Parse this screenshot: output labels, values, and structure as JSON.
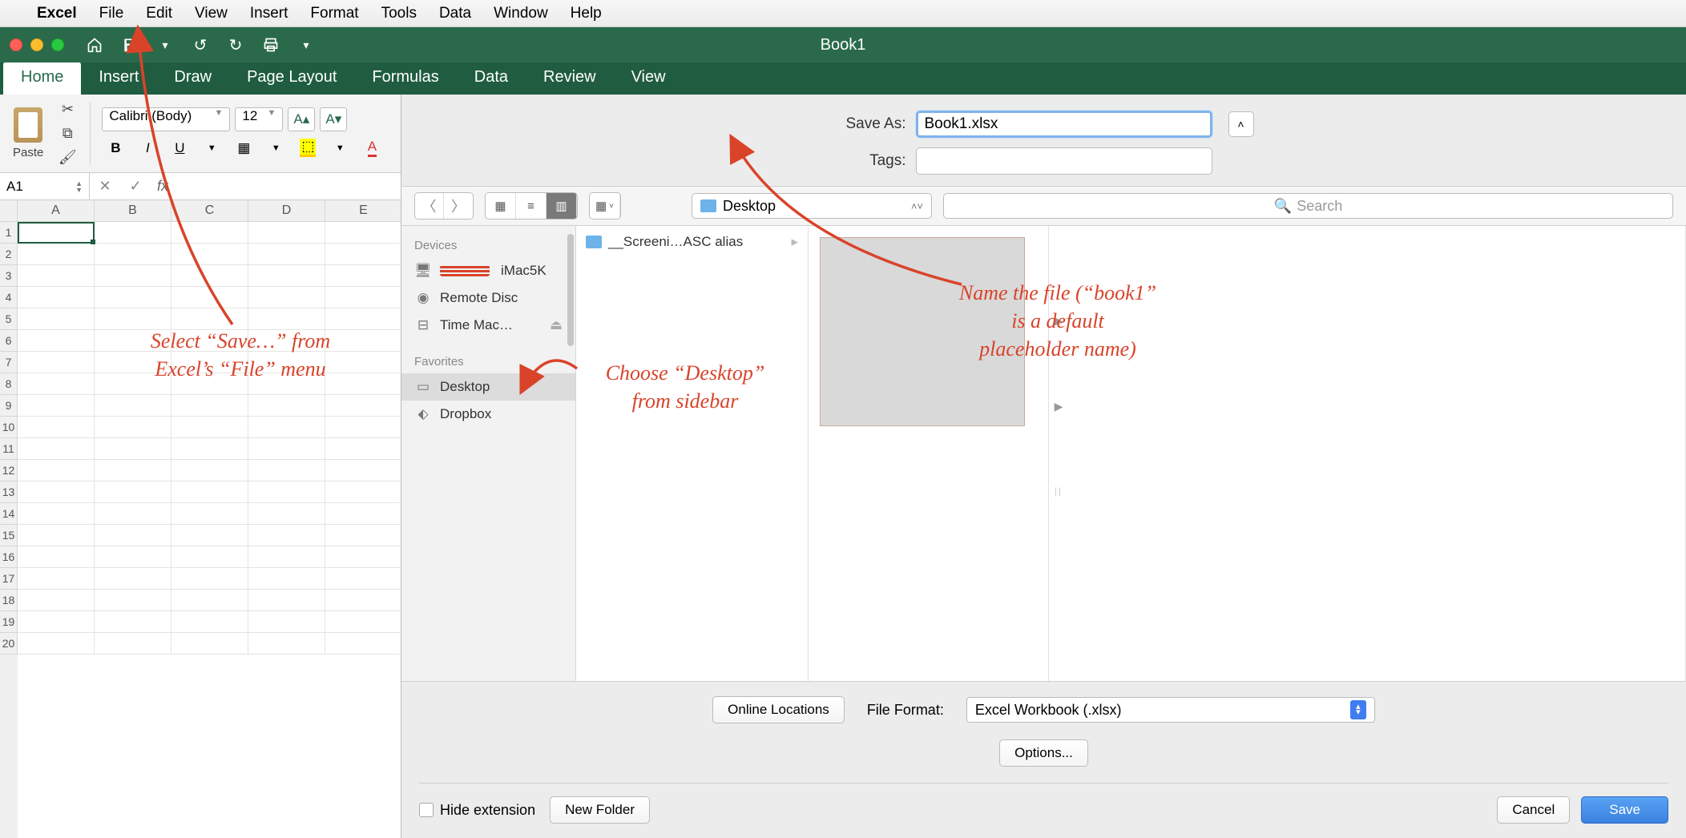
{
  "menubar": {
    "items": [
      "Excel",
      "File",
      "Edit",
      "View",
      "Insert",
      "Format",
      "Tools",
      "Data",
      "Window",
      "Help"
    ]
  },
  "titlebar": {
    "title": "Book1"
  },
  "ribbon_tabs": [
    "Home",
    "Insert",
    "Draw",
    "Page Layout",
    "Formulas",
    "Data",
    "Review",
    "View"
  ],
  "ribbon": {
    "paste_label": "Paste",
    "font_name": "Calibri (Body)",
    "font_size": "12"
  },
  "formula_bar": {
    "cell_ref": "A1",
    "fx_label": "fx"
  },
  "sheet": {
    "columns": [
      "A",
      "B",
      "C",
      "D",
      "E"
    ],
    "row_count": 20
  },
  "save_dialog": {
    "save_as_label": "Save As:",
    "filename": "Book1.xlsx",
    "tags_label": "Tags:",
    "tags_value": "",
    "location_label": "Desktop",
    "search_placeholder": "Search",
    "sidebar": {
      "devices_header": "Devices",
      "devices": [
        "iMac5K",
        "Remote Disc",
        "Time Mac…"
      ],
      "favorites_header": "Favorites",
      "favorites": [
        "Desktop",
        "Dropbox"
      ]
    },
    "file_list": {
      "item1": "__Screeni…ASC alias"
    },
    "online_locations": "Online Locations",
    "file_format_label": "File Format:",
    "file_format_value": "Excel Workbook (.xlsx)",
    "options_btn": "Options...",
    "hide_extension": "Hide extension",
    "new_folder": "New Folder",
    "cancel": "Cancel",
    "save": "Save"
  },
  "annotations": {
    "a1": "Select “Save…” from\nExcel’s “File” menu",
    "a2": "Choose “Desktop”\nfrom sidebar",
    "a3": "Name the file (“book1”\nis a default\nplaceholder name)"
  }
}
